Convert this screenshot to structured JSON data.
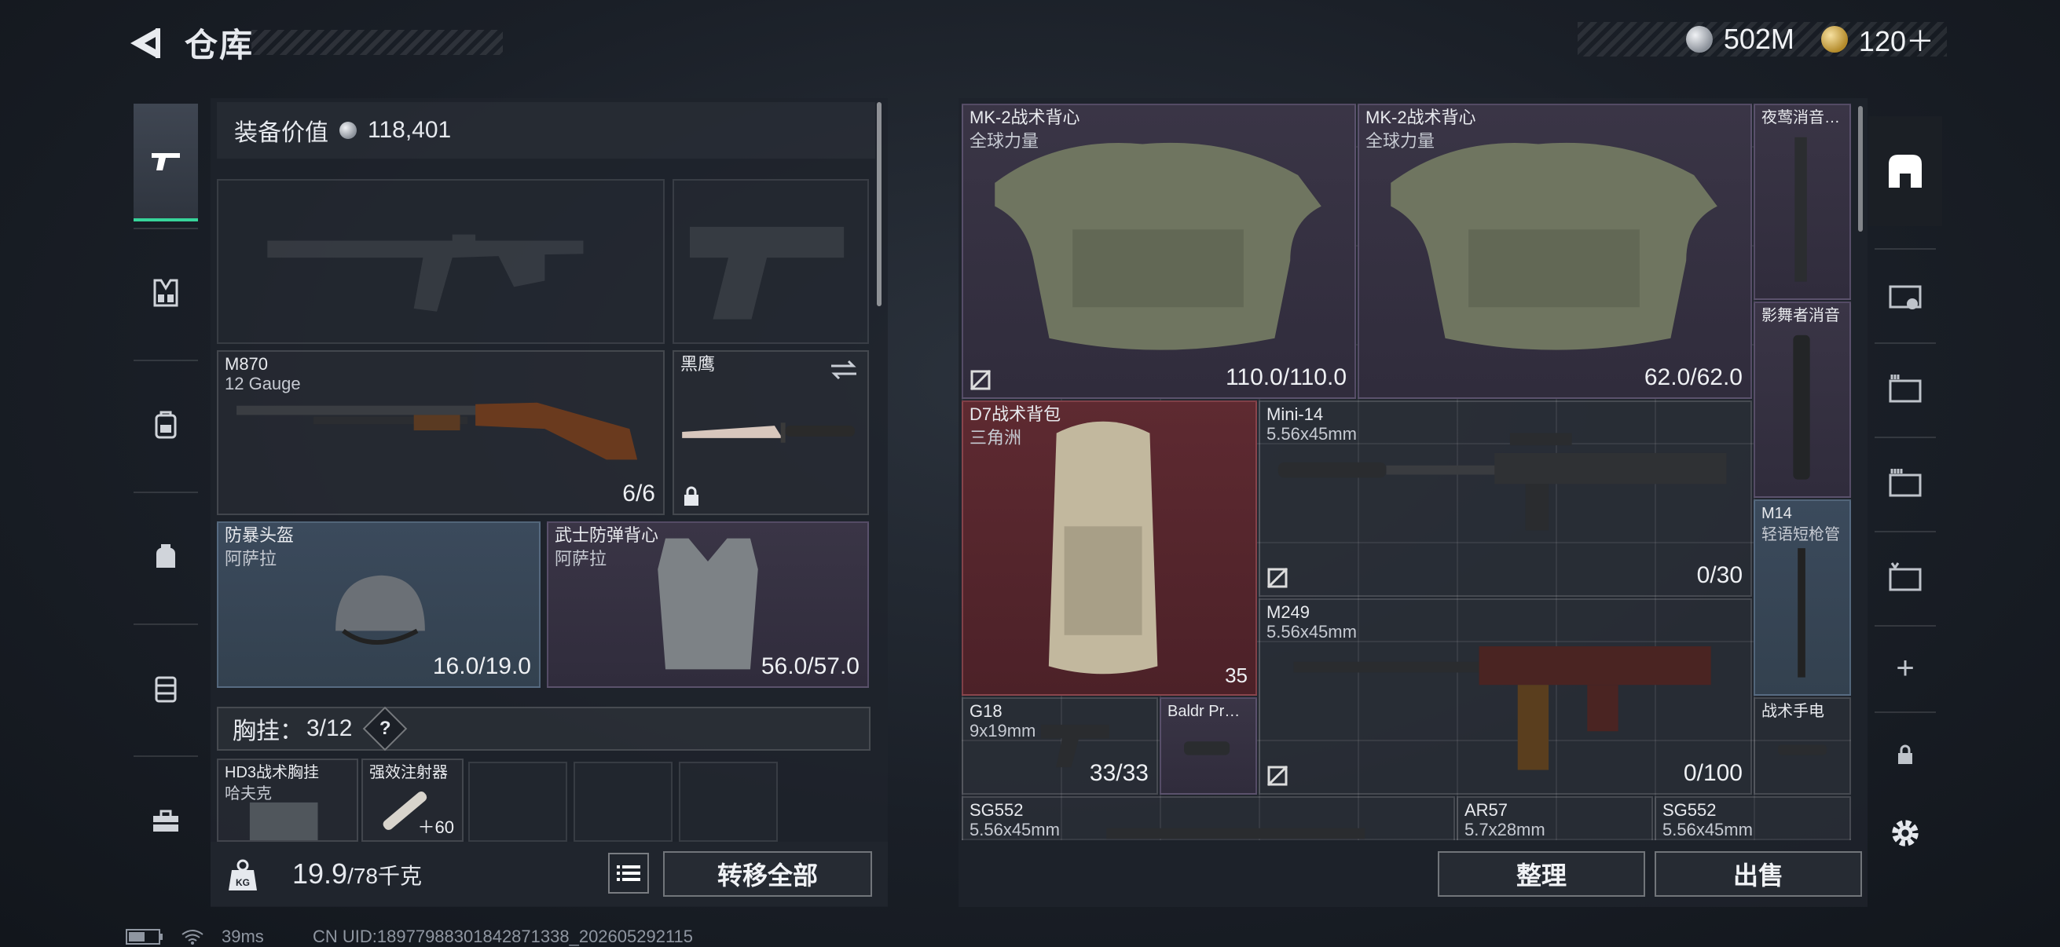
{
  "header": {
    "title": "仓库",
    "currency": [
      {
        "icon": "silver-coin-icon",
        "value": "502M"
      },
      {
        "icon": "gold-coin-icon",
        "value": "120＋"
      }
    ]
  },
  "left_nav": {
    "items": [
      {
        "icon": "pistol-icon",
        "active": true
      },
      {
        "icon": "chest-rig-icon"
      },
      {
        "icon": "backpack-icon"
      },
      {
        "icon": "pouch-icon"
      },
      {
        "icon": "container-icon"
      },
      {
        "icon": "toolbox-icon"
      }
    ]
  },
  "equipment": {
    "value_label": "装备价值",
    "value": "118,401",
    "primary_weapon": {
      "name": "M870",
      "caliber": "12 Gauge",
      "ammo": "6/6"
    },
    "melee": {
      "name": "黑鹰"
    },
    "helmet": {
      "name": "防暴头盔",
      "brand": "阿萨拉",
      "durability": "16.0/19.0"
    },
    "armor": {
      "name": "武士防弹背心",
      "brand": "阿萨拉",
      "durability": "56.0/57.0"
    },
    "chest_rig": {
      "label": "胸挂：",
      "count": "3/12",
      "help": "?"
    },
    "rig_items": [
      {
        "name": "HD3战术胸挂",
        "sub": "哈夫克"
      },
      {
        "name": "强效注射器",
        "sub": "＋60"
      }
    ]
  },
  "bottom_left": {
    "weight": "19.9",
    "weight_max": "/78千克",
    "kg_label": "KG",
    "transfer_all": "转移全部"
  },
  "storage": {
    "items": [
      {
        "name": "MK-2战术背心",
        "sub": "全球力量",
        "value": "110.0/110.0"
      },
      {
        "name": "MK-2战术背心",
        "sub": "全球力量",
        "value": "62.0/62.0"
      },
      {
        "name": "夜莺消音…"
      },
      {
        "name": "影舞者消音"
      },
      {
        "name": "D7战术背包",
        "sub": "三角洲",
        "value": "35"
      },
      {
        "name": "Mini-14",
        "sub": "5.56x45mm",
        "value": "0/30"
      },
      {
        "name": "M14",
        "sub": "轻语短枪管"
      },
      {
        "name": "M249",
        "sub": "5.56x45mm",
        "value": "0/100"
      },
      {
        "name": "G18",
        "sub": "9x19mm",
        "value": "33/33"
      },
      {
        "name": "Baldr Pr…"
      },
      {
        "name": "战术手电"
      },
      {
        "name": "SG552",
        "sub": "5.56x45mm"
      },
      {
        "name": "AR57",
        "sub": "5.7x28mm"
      },
      {
        "name": "SG552",
        "sub": "5.56x45mm"
      }
    ],
    "sort_button": "整理",
    "sell_button": "出售"
  },
  "right_nav": {
    "items": [
      {
        "icon": "storage-tab-icon",
        "active": true
      },
      {
        "icon": "storage-tab-1-icon"
      },
      {
        "icon": "storage-tab-2-icon"
      },
      {
        "icon": "storage-tab-3-icon"
      },
      {
        "icon": "storage-tab-v-icon"
      },
      {
        "icon": "add-icon",
        "label": "+"
      },
      {
        "icon": "lock-icon"
      },
      {
        "icon": "gear-icon"
      }
    ]
  },
  "status_bar": {
    "ping": "39ms",
    "uid": "CN UID:18977988301842871338_202605292115"
  },
  "colors": {
    "accent": "#37d49a",
    "rarity_blue": "#3b4a5c",
    "rarity_purple": "#3a3546",
    "rarity_red": "#5e2a31"
  }
}
